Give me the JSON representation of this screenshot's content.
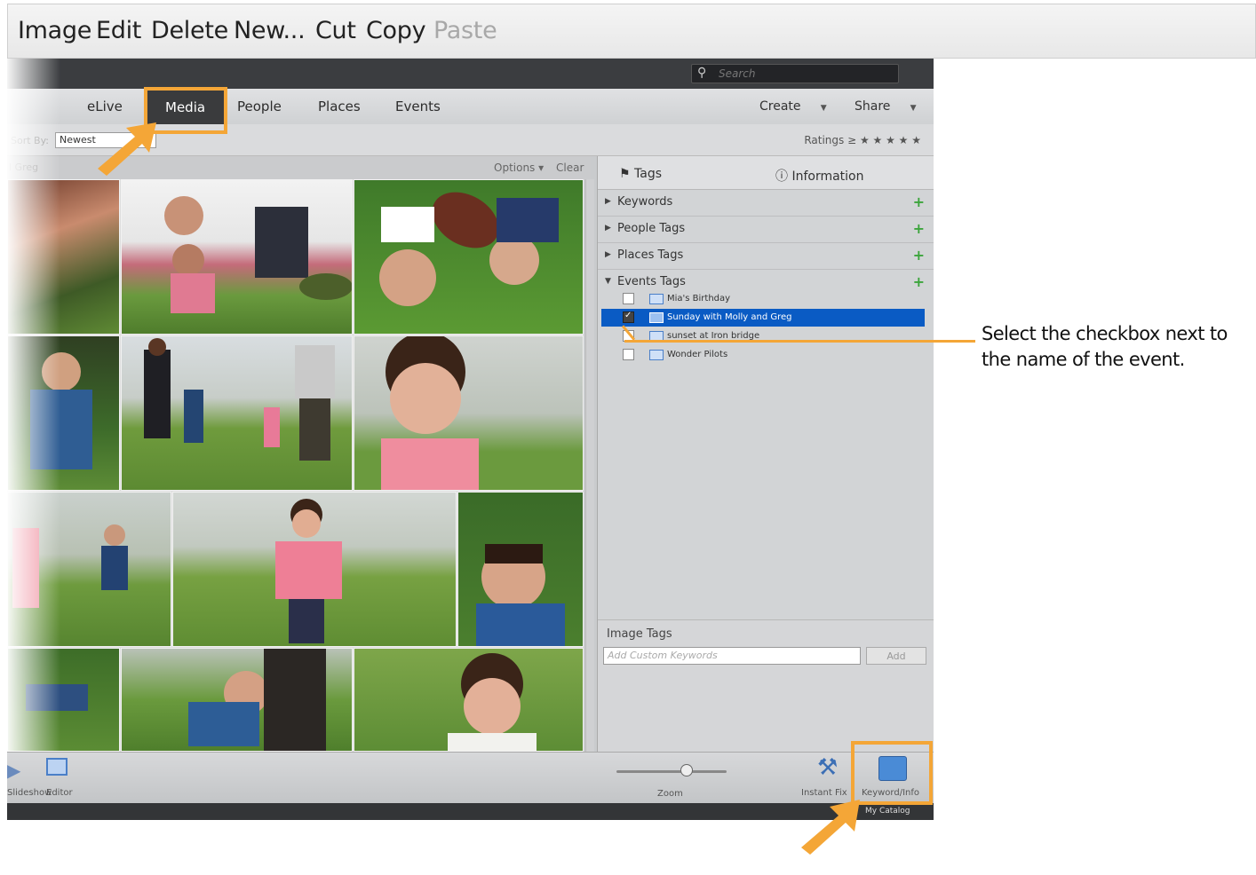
{
  "menubar": {
    "items": [
      {
        "label": "Image",
        "enabled": true
      },
      {
        "label": "Edit",
        "enabled": true
      },
      {
        "label": "Delete",
        "enabled": true
      },
      {
        "label": "New...",
        "enabled": true
      },
      {
        "label": "Cut",
        "enabled": true
      },
      {
        "label": "Copy",
        "enabled": true
      },
      {
        "label": "Paste",
        "enabled": false
      }
    ]
  },
  "search": {
    "placeholder": "Search"
  },
  "nav": {
    "tabs": [
      "eLive",
      "Media",
      "People",
      "Places",
      "Events"
    ],
    "active": "Media",
    "create": "Create",
    "share": "Share"
  },
  "sortbar": {
    "label": "Sort By:",
    "value": "Newest",
    "ratings": "Ratings ≥ ★ ★ ★ ★ ★"
  },
  "gridheader": {
    "left": "l Greg",
    "options": "Options ▾",
    "clear": "Clear"
  },
  "panel": {
    "tab_tags": "Tags",
    "tab_info": "Information",
    "sections": [
      "Keywords",
      "People Tags",
      "Places Tags",
      "Events Tags"
    ],
    "event_tags": [
      {
        "name": "Mia's Birthday",
        "checked": false,
        "selected": false
      },
      {
        "name": "Sunday with Molly and Greg",
        "checked": true,
        "selected": true
      },
      {
        "name": "sunset at Iron bridge",
        "checked": false,
        "selected": false
      },
      {
        "name": "Wonder Pilots",
        "checked": false,
        "selected": false
      }
    ],
    "image_tags_title": "Image Tags",
    "keyword_placeholder": "Add Custom Keywords",
    "add": "Add"
  },
  "bottombar": {
    "slideshow": "Slideshow",
    "editor": "Editor",
    "zoom": "Zoom",
    "instant_fix": "Instant Fix",
    "keyword_info": "Keyword/Info",
    "catalog": "My Catalog"
  },
  "callout": "Select the checkbox next to the name of the event.",
  "colors": {
    "highlight": "#f4a637",
    "selection": "#0a5bc4"
  }
}
